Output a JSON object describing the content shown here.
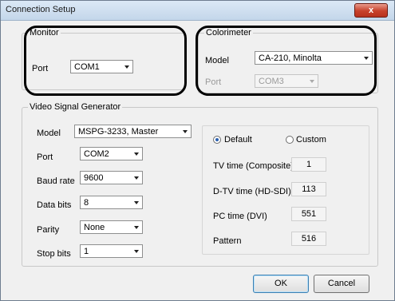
{
  "window": {
    "title": "Connection Setup",
    "close_glyph": "x"
  },
  "monitor": {
    "group_label": "Monitor",
    "port_label": "Port",
    "port_value": "COM1"
  },
  "colorimeter": {
    "group_label": "Colorimeter",
    "model_label": "Model",
    "model_value": "CA-210, Minolta",
    "port_label": "Port",
    "port_value": "COM3"
  },
  "vsg": {
    "group_label": "Video Signal Generator",
    "model_label": "Model",
    "model_value": "MSPG-3233, Master",
    "port_label": "Port",
    "port_value": "COM2",
    "baud_label": "Baud rate",
    "baud_value": "9600",
    "databits_label": "Data bits",
    "databits_value": "8",
    "parity_label": "Parity",
    "parity_value": "None",
    "stopbits_label": "Stop bits",
    "stopbits_value": "1",
    "default_label": "Default",
    "custom_label": "Custom",
    "selected_mode": "Default",
    "tv_label": "TV time (Composite)",
    "tv_value": "1",
    "dtv_label": "D-TV time (HD-SDI)",
    "dtv_value": "113",
    "pc_label": "PC time (DVI)",
    "pc_value": "551",
    "pattern_label": "Pattern",
    "pattern_value": "516"
  },
  "buttons": {
    "ok": "OK",
    "cancel": "Cancel"
  }
}
